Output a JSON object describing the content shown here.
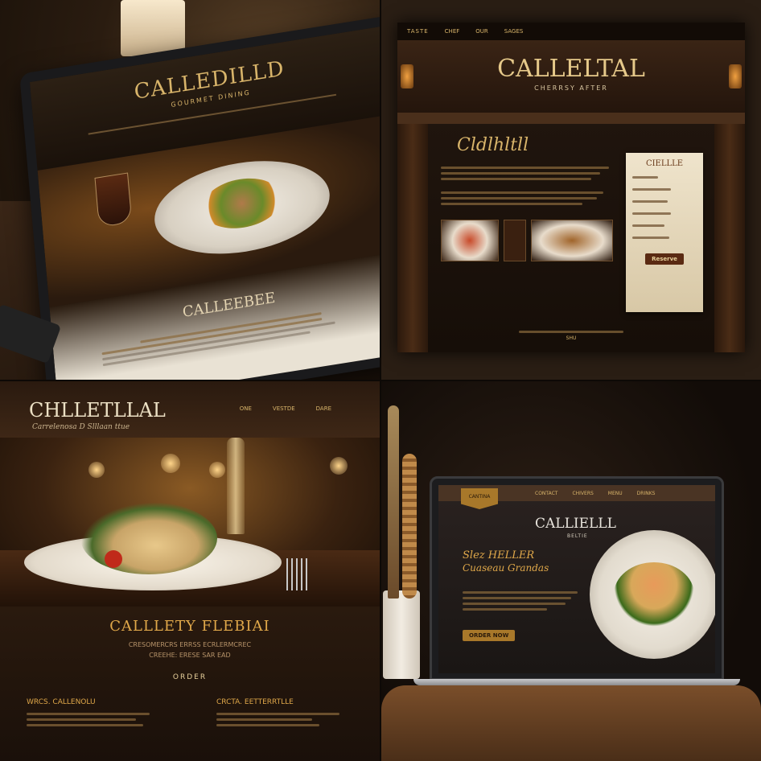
{
  "panels": {
    "tablet": {
      "logo": "CALLEDILLD",
      "subtitle": "GOURMET DINING",
      "section_title": "CALLEEBEE"
    },
    "website_dark": {
      "top_mark": "TASTE",
      "nav": [
        "CHEF",
        "OUR",
        "SAGES"
      ],
      "logo": "CALLELTAL",
      "tagline": "CHERRSY AFTER",
      "script_title": "Cldlhltll",
      "menu_card_title": "CIELLLE",
      "menu_card_button": "Reserve",
      "footer": "SHU"
    },
    "website_warm": {
      "logo": "CHLLETLLAL",
      "tagline": "Carrelenosa D Slllaan ttue",
      "nav": [
        "ONE",
        "VESTDE",
        "DARE"
      ],
      "headline": "CALLLETY FLEBIAI",
      "body_lines": [
        "CRESOMERCRS ERRSS ECRLERMCREC",
        "CREEHE: ERESE SAR EAD"
      ],
      "cta": "ORDER",
      "footer_titles": [
        "WRCS. CALLENOLU",
        "CRCTA. EETTERRTLLE"
      ]
    },
    "laptop": {
      "badge": "CANTINA",
      "nav": [
        "CONTACT",
        "CHIVERS",
        "MENU",
        "DRINKS"
      ],
      "logo": "CALLIELLL",
      "sublogo": "BELTIE",
      "script": "Slez HELLER",
      "script2": "Cuaseau Grandas",
      "cta": "ORDER NOW"
    }
  },
  "colors": {
    "gold": "#d8b46a",
    "wood": "#4a2f1b",
    "parchment": "#efe4cc"
  }
}
